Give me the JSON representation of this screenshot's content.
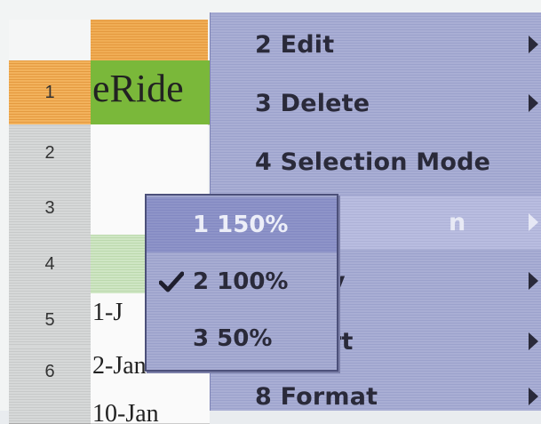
{
  "sheet": {
    "row_numbers": [
      "1",
      "2",
      "3",
      "4",
      "5",
      "6"
    ],
    "title_cell": "eRide",
    "dates": [
      "1-J",
      "2-Jan",
      "10-Jan"
    ]
  },
  "context_menu": {
    "items": [
      {
        "label": "2 Edit",
        "has_submenu": true
      },
      {
        "label": "3 Delete",
        "has_submenu": true
      },
      {
        "label": "4 Selection Mode",
        "has_submenu": false
      },
      {
        "label": "n",
        "has_submenu": true
      },
      {
        "label": "y",
        "has_submenu": true
      },
      {
        "label": "rt",
        "has_submenu": true
      },
      {
        "label": "8 Format",
        "has_submenu": true
      }
    ]
  },
  "zoom_submenu": {
    "items": [
      {
        "label": "1 150%",
        "checked": false,
        "highlighted": true
      },
      {
        "label": "2 100%",
        "checked": true,
        "highlighted": false
      },
      {
        "label": "3 50%",
        "checked": false,
        "highlighted": false
      }
    ]
  }
}
